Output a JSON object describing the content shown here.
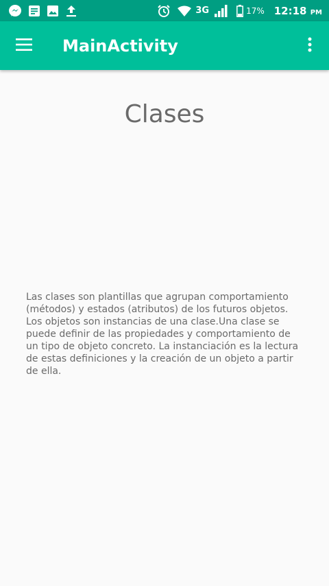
{
  "status_bar": {
    "network_type": "3G",
    "battery_percent": "17%",
    "time": "12:18",
    "ampm": "PM",
    "icons": [
      "messenger-icon",
      "notes-icon",
      "image-icon",
      "upload-icon",
      "alarm-icon",
      "wifi-icon",
      "signal-icon",
      "battery-icon"
    ]
  },
  "app_bar": {
    "title": "MainActivity",
    "menu_icon": "hamburger-menu-icon",
    "overflow_icon": "more-vert-icon",
    "color": "#00bf9a",
    "status_color": "#009e82"
  },
  "content": {
    "heading": "Clases",
    "paragraph": "Las clases son plantillas que agrupan comportamiento (métodos) y estados (atributos) de los futuros objetos. Los objetos son instancias de una clase.Una clase se puede definir de las propiedades y comportamiento de un tipo de objeto concreto. La instanciación es la lectura de estas definiciones y la creación de un objeto a partir de ella."
  }
}
